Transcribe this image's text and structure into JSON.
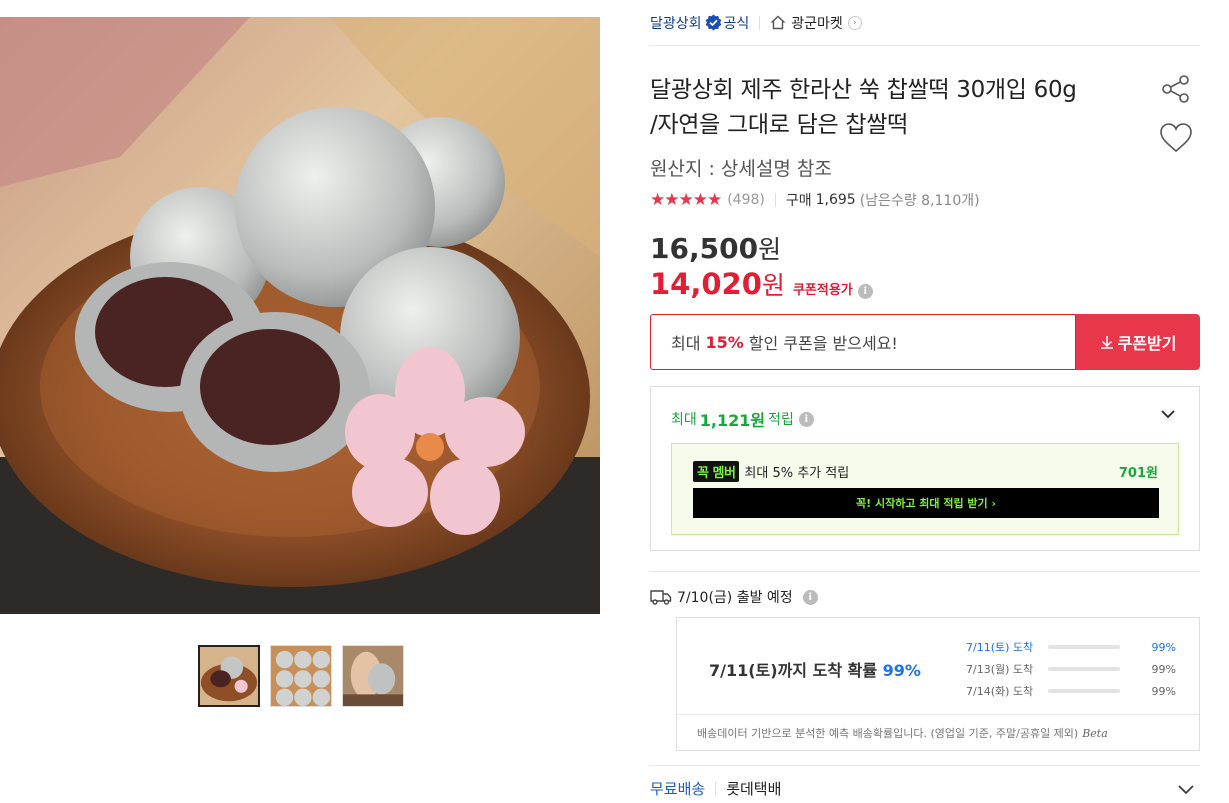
{
  "seller": {
    "name": "달광상회",
    "official_label": "공식",
    "market_name": "광군마켓"
  },
  "product": {
    "title_line1": "달광상회 제주 한라산 쑥 찹쌀떡 30개입 60g",
    "title_line2": "/자연을 그대로 담은 찹쌀떡",
    "origin": "원산지 : 상세설명 참조"
  },
  "rating": {
    "stars": "★★★★★",
    "reviews": "(498)",
    "purchase_label": "구매",
    "purchase_count": "1,695",
    "stock": "(남은수량 8,110개)"
  },
  "price": {
    "original": "16,500",
    "sale": "14,020",
    "won": "원",
    "coupon_tag": "쿠폰적용가"
  },
  "coupon": {
    "prefix": "최대",
    "percent": "15%",
    "suffix": "할인 쿠폰을 받으세요!",
    "button": "쿠폰받기"
  },
  "points": {
    "prefix": "최대",
    "amount": "1,121원",
    "suffix": "적립",
    "member_badge": "꼭 멤버",
    "member_text": "최대 5% 추가 적립",
    "member_amount": "701원",
    "member_cta": "꼭! 시작하고 최대 적립 받기 ›"
  },
  "shipping": {
    "departure": "7/10(금) 출발 예정",
    "arrival_main": "7/11(토)까지 도착 확률",
    "arrival_pct": "99%",
    "estimates": [
      {
        "date": "7/11(토) 도착",
        "pct": "99%",
        "fill": 1.0
      },
      {
        "date": "7/13(월) 도착",
        "pct": "99%",
        "fill": 0.0
      },
      {
        "date": "7/14(화) 도착",
        "pct": "99%",
        "fill": 0.0
      }
    ],
    "footnote": "배송데이터 기반으로 분석한 예측 배송확률입니다. (영업일 기준, 주말/공휴일 제외)",
    "beta": "Beta",
    "free_label": "무료배송",
    "carrier": "롯데택배"
  },
  "colors": {
    "accent_red": "#e8374a",
    "price_red": "#e01e34",
    "green": "#17a83b",
    "blue": "#1a73e8",
    "seller_blue": "#0d3d8c"
  }
}
